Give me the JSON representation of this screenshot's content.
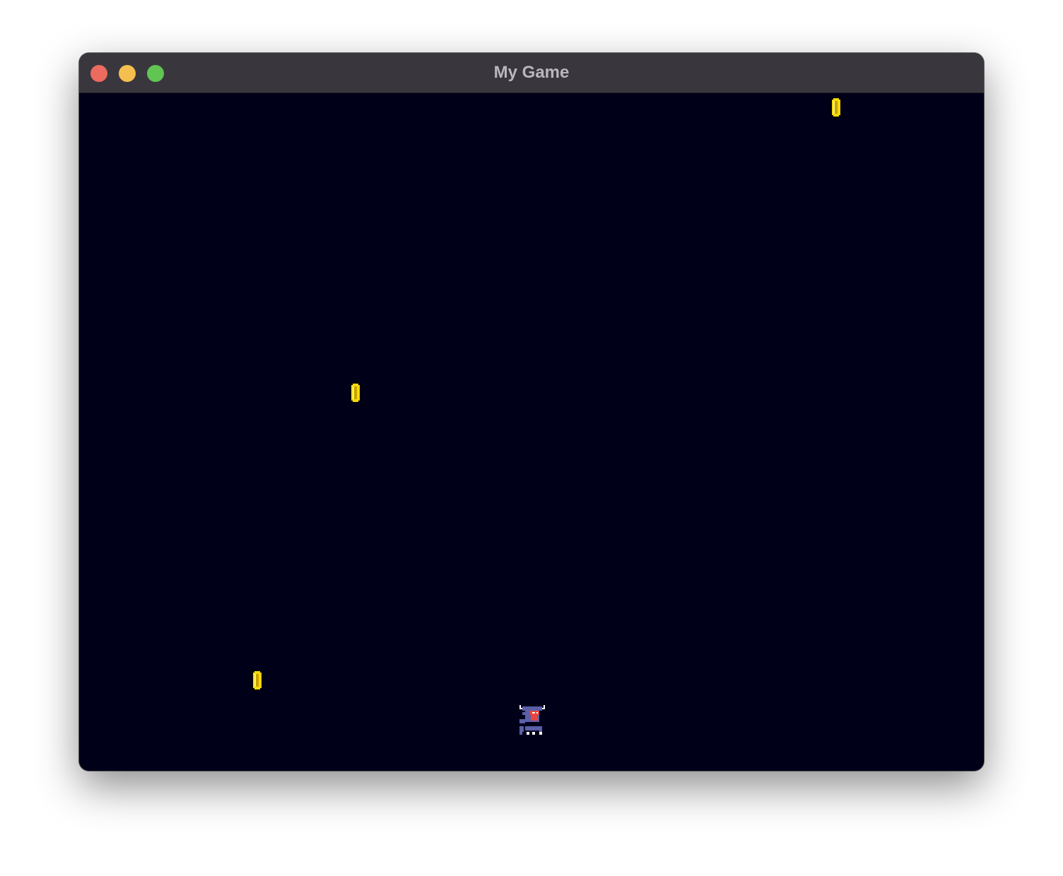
{
  "window": {
    "title": "My Game",
    "controls": {
      "close_color": "#ed6a5e",
      "minimize_color": "#f5bf4f",
      "zoom_color": "#61c554"
    }
  },
  "game": {
    "background_color": "#000019",
    "coin_count": 3,
    "coin_color": "#f5d90a",
    "player": {
      "primary_color": "#5b5fa8",
      "accent_color": "#e8453c"
    }
  }
}
